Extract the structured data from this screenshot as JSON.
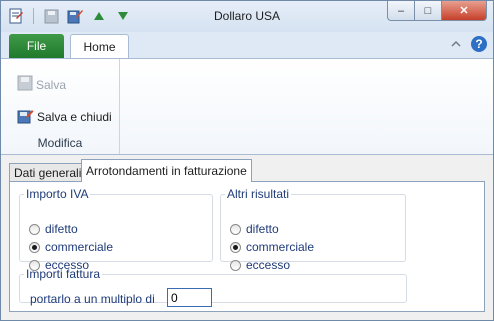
{
  "window": {
    "title": "Dollaro USA"
  },
  "title_buttons": {
    "minimize": "–",
    "maximize": "□",
    "close": "✕"
  },
  "ribbon": {
    "tabs": {
      "file": "File",
      "home": "Home"
    },
    "help": "?",
    "group": {
      "label": "Modifica",
      "save": "Salva",
      "save_close": "Salva e chiudi"
    }
  },
  "tabs": {
    "general": "Dati generali",
    "rounding": "Arrotondamenti in fatturazione"
  },
  "iva": {
    "legend": "Importo IVA",
    "options": [
      "difetto",
      "commerciale",
      "eccesso"
    ],
    "selected": "commerciale"
  },
  "altri": {
    "legend": "Altri risultati",
    "options": [
      "difetto",
      "commerciale",
      "eccesso"
    ],
    "selected": "commerciale"
  },
  "importi": {
    "legend": "Importi fattura",
    "label": "portarlo a un multiplo di",
    "value": "0"
  },
  "colors": {
    "file_tab": "#2b8a3e",
    "accent": "#1f3b78",
    "ribbon_border": "#a9bcd3"
  }
}
